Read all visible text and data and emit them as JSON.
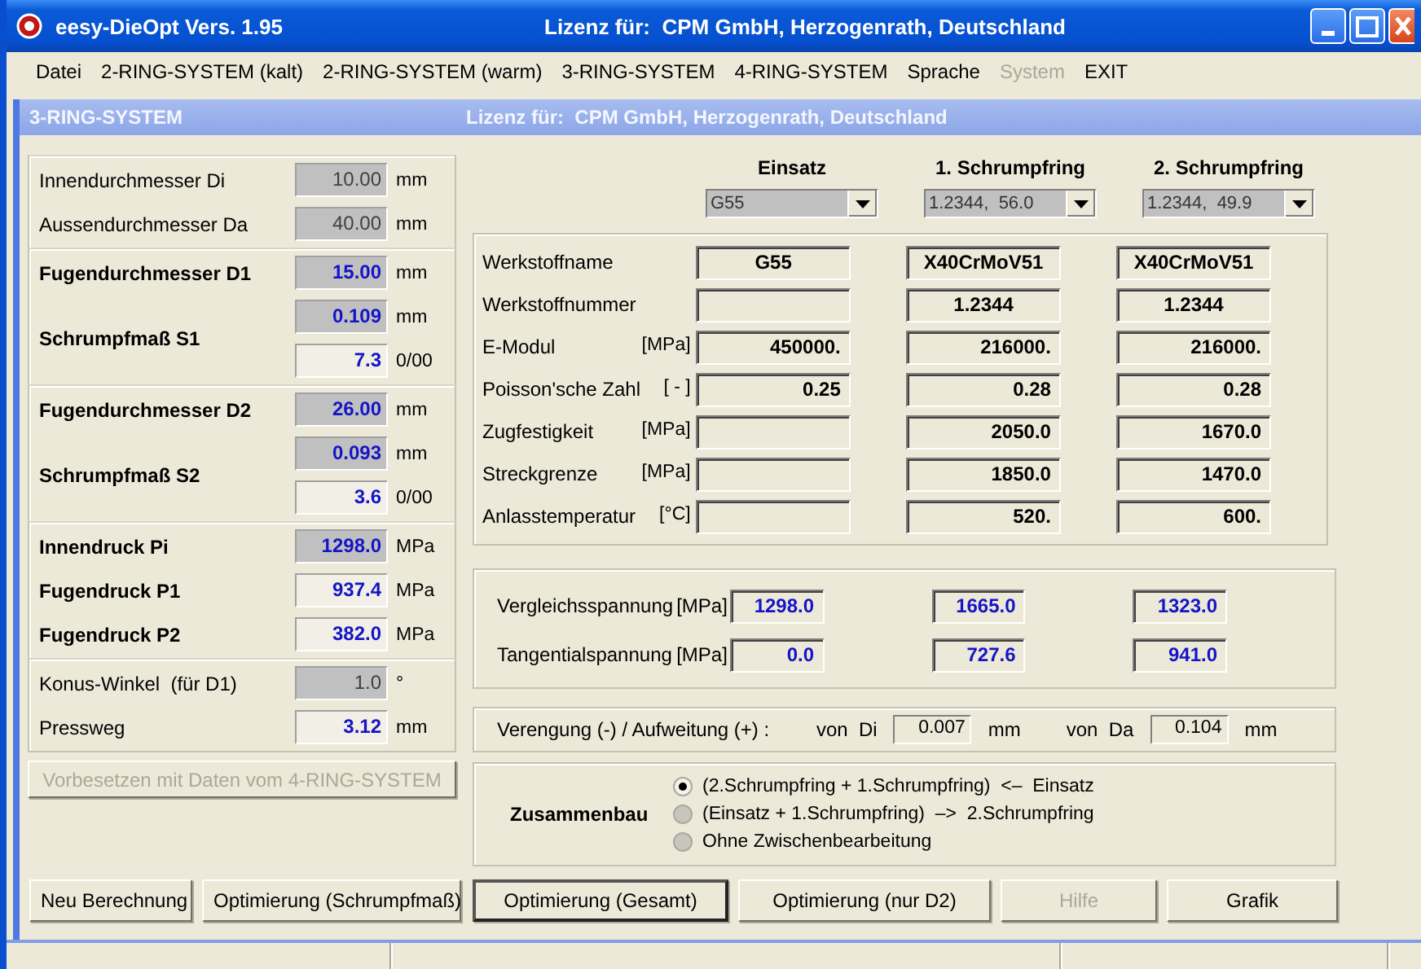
{
  "window": {
    "title": "eesy-DieOpt Vers. 1.95",
    "license": "Lizenz für:  CPM GmbH, Herzogenrath, Deutschland"
  },
  "menu": [
    {
      "label": "Datei",
      "disabled": false
    },
    {
      "label": "2-RING-SYSTEM (kalt)",
      "disabled": false
    },
    {
      "label": "2-RING-SYSTEM (warm)",
      "disabled": false
    },
    {
      "label": "3-RING-SYSTEM",
      "disabled": false
    },
    {
      "label": "4-RING-SYSTEM",
      "disabled": false
    },
    {
      "label": "Sprache",
      "disabled": false
    },
    {
      "label": "System",
      "disabled": true
    },
    {
      "label": "EXIT",
      "disabled": false
    }
  ],
  "child_window": {
    "title": "3-RING-SYSTEM",
    "license": "Lizenz für:  CPM GmbH, Herzogenrath, Deutschland"
  },
  "geometry_groups": [
    {
      "rows": [
        {
          "label": "Innendurchmesser Di",
          "kind": "minor",
          "fields": [
            {
              "value": "10.00",
              "unit": "mm",
              "readonly": true,
              "computed": false
            }
          ]
        },
        {
          "label": "Aussendurchmesser Da",
          "kind": "minor",
          "fields": [
            {
              "value": "40.00",
              "unit": "mm",
              "readonly": true,
              "computed": false
            }
          ]
        }
      ]
    },
    {
      "rows": [
        {
          "label": "Fugendurchmesser D1",
          "kind": "main",
          "fields": [
            {
              "value": "15.00",
              "unit": "mm",
              "readonly": true,
              "computed": true
            }
          ]
        },
        {
          "label": "Schrumpfmaß S1",
          "kind": "main",
          "fields": [
            {
              "value": "0.109",
              "unit": "mm",
              "readonly": true,
              "computed": true
            },
            {
              "value": "7.3",
              "unit": "0/00",
              "readonly": false,
              "computed": true
            }
          ]
        }
      ]
    },
    {
      "rows": [
        {
          "label": "Fugendurchmesser D2",
          "kind": "main",
          "fields": [
            {
              "value": "26.00",
              "unit": "mm",
              "readonly": true,
              "computed": true
            }
          ]
        },
        {
          "label": "Schrumpfmaß S2",
          "kind": "main",
          "fields": [
            {
              "value": "0.093",
              "unit": "mm",
              "readonly": true,
              "computed": true
            },
            {
              "value": "3.6",
              "unit": "0/00",
              "readonly": false,
              "computed": true
            }
          ]
        }
      ]
    },
    {
      "rows": [
        {
          "label": "Innendruck Pi",
          "kind": "main",
          "fields": [
            {
              "value": "1298.0",
              "unit": "MPa",
              "readonly": true,
              "computed": true
            }
          ]
        },
        {
          "label": "Fugendruck P1",
          "kind": "main",
          "fields": [
            {
              "value": "937.4",
              "unit": "MPa",
              "readonly": false,
              "computed": true
            }
          ]
        },
        {
          "label": "Fugendruck P2",
          "kind": "main",
          "fields": [
            {
              "value": "382.0",
              "unit": "MPa",
              "readonly": false,
              "computed": true
            }
          ]
        }
      ]
    },
    {
      "rows": [
        {
          "label": "Konus-Winkel  (für D1)",
          "kind": "minor",
          "fields": [
            {
              "value": "1.0",
              "unit": "°",
              "readonly": true,
              "computed": false
            }
          ]
        },
        {
          "label": "Pressweg",
          "kind": "minor",
          "fields": [
            {
              "value": "3.12",
              "unit": "mm",
              "readonly": false,
              "computed": true
            }
          ]
        }
      ]
    }
  ],
  "preset_button": {
    "label": "Vorbesetzen mit Daten vom 4-RING-SYSTEM",
    "disabled": true
  },
  "material_columns": [
    {
      "header": "Einsatz",
      "selection": "G55"
    },
    {
      "header": "1. Schrumpfring",
      "selection": "1.2344,  56.0"
    },
    {
      "header": "2. Schrumpfring",
      "selection": "1.2344,  49.9"
    }
  ],
  "material_properties": [
    {
      "label": "Werkstoffname",
      "kind": "text",
      "values": {
        "einsatz": "G55",
        "ring_1": "X40CrMoV51",
        "ring_2": "X40CrMoV51"
      }
    },
    {
      "label": "Werkstoffnummer",
      "kind": "text",
      "values": {
        "ring_1": "1.2344",
        "ring_2": "1.2344"
      }
    },
    {
      "label": "E-Modul",
      "unit": "[MPa]",
      "kind": "number",
      "values": {
        "einsatz": "450000.",
        "ring_1": "216000.",
        "ring_2": "216000."
      }
    },
    {
      "label": "Poisson'sche Zahl",
      "unit": "[ - ]",
      "kind": "number",
      "values": {
        "einsatz": "0.25",
        "ring_1": "0.28",
        "ring_2": "0.28"
      }
    },
    {
      "label": "Zugfestigkeit",
      "unit": "[MPa]",
      "kind": "number",
      "values": {
        "ring_1": "2050.0",
        "ring_2": "1670.0"
      }
    },
    {
      "label": "Streckgrenze",
      "unit": "[MPa]",
      "kind": "number",
      "values": {
        "ring_1": "1850.0",
        "ring_2": "1470.0"
      }
    },
    {
      "label": "Anlasstemperatur",
      "unit": "[°C]",
      "kind": "number",
      "values": {
        "ring_1": "520.",
        "ring_2": "600."
      }
    }
  ],
  "stresses": [
    {
      "label": "Vergleichsspannung",
      "unit": "[MPa]",
      "values": [
        "1298.0",
        "1665.0",
        "1323.0"
      ]
    },
    {
      "label": "Tangentialspannung",
      "unit": "[MPa]",
      "values": [
        "0.0",
        "727.6",
        "941.0"
      ]
    }
  ],
  "deformation": {
    "label": "Verengung (-) / Aufweitung (+) :",
    "measures": [
      {
        "label": "von  Di",
        "value": "0.007",
        "unit": "mm"
      },
      {
        "label": "von  Da",
        "value": "0.104",
        "unit": "mm"
      }
    ]
  },
  "assembly": {
    "label": "Zusammenbau",
    "options": [
      {
        "label": "(2.Schrumpfring + 1.Schrumpfring)  <–  Einsatz",
        "selected": true
      },
      {
        "label": "(Einsatz + 1.Schrumpfring)  –>  2.Schrumpfring",
        "selected": false
      },
      {
        "label": "Ohne Zwischenbearbeitung",
        "selected": false
      }
    ]
  },
  "buttons": [
    {
      "label": "Neu Berechnung",
      "disabled": false,
      "default": false
    },
    {
      "label": "Optimierung (Schrumpfmaß)",
      "disabled": false,
      "default": false
    },
    {
      "label": "Optimierung (Gesamt)",
      "disabled": false,
      "default": true
    },
    {
      "label": "Optimierung (nur D2)",
      "disabled": false,
      "default": false
    },
    {
      "label": "Hilfe",
      "disabled": true,
      "default": false
    },
    {
      "label": "Grafik",
      "disabled": false,
      "default": false
    }
  ]
}
